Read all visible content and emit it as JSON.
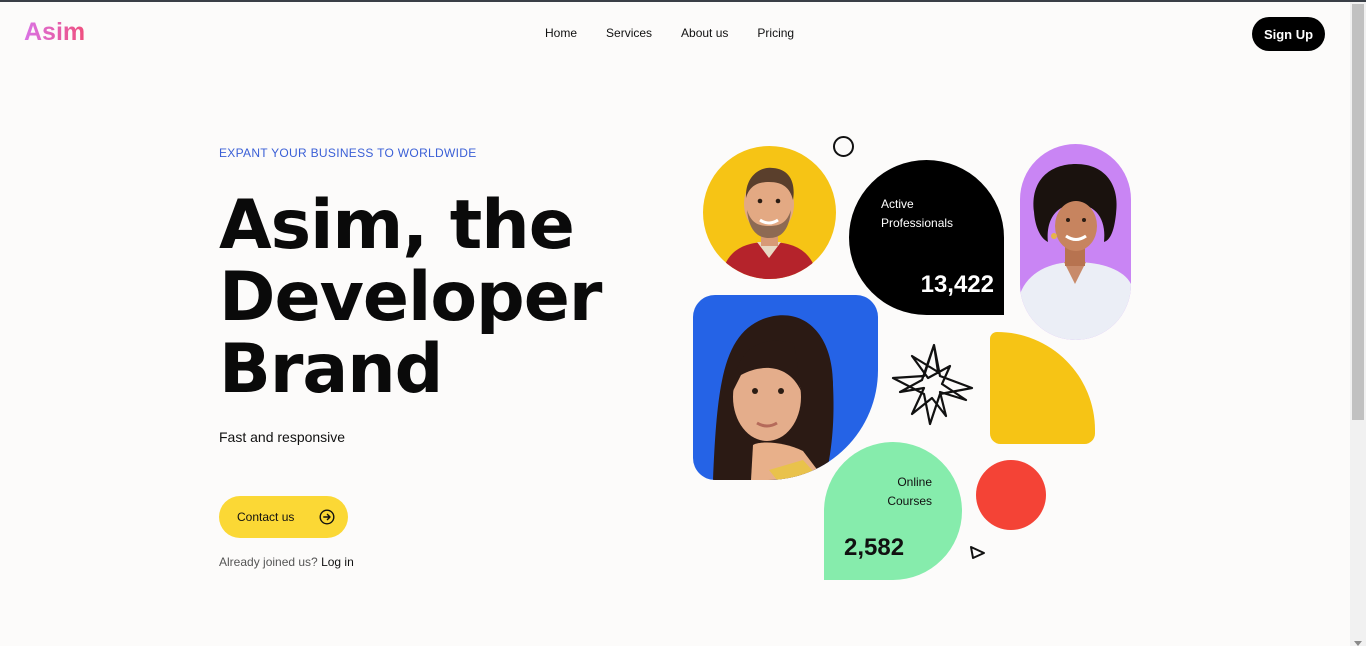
{
  "header": {
    "logo": "Asim",
    "nav": [
      "Home",
      "Services",
      "About us",
      "Pricing"
    ],
    "signup_label": "Sign Up"
  },
  "hero": {
    "tagline": "EXPANT YOUR BUSINESS TO WORLDWIDE",
    "headline": [
      "Asim, the",
      "Developer",
      "Brand"
    ],
    "subtitle": "Fast and responsive",
    "contact_label": "Contact us",
    "login_prompt": "Already joined us?",
    "login_link": "Log in"
  },
  "stats": {
    "professionals": {
      "label_line1": "Active",
      "label_line2": "Professionals",
      "value": "13,422"
    },
    "courses": {
      "label_line1": "Online",
      "label_line2": "Courses",
      "value": "2,582"
    }
  },
  "colors": {
    "accent_blue": "#3a5fd6",
    "button_yellow": "#fbd835",
    "tile_yellow": "#f6c415",
    "tile_purple": "#c985f4",
    "tile_blue": "#2563e6",
    "tile_green": "#86ecac",
    "tile_red": "#f44336"
  },
  "icons": {
    "contact_icon": "arrow-right-circle-icon",
    "decor": [
      "sparkle-star-icon",
      "triangle-outline-icon",
      "circle-outline-icon"
    ]
  }
}
